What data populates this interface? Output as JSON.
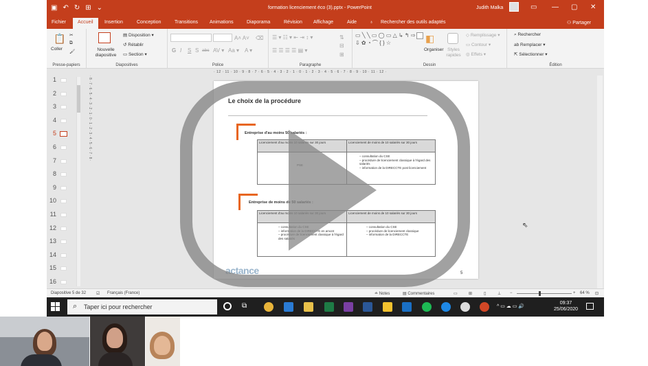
{
  "window": {
    "title": "formation licenciement éco (3).pptx - PowerPoint",
    "user": "Judith Malka",
    "min_icon": "minimize-icon",
    "max_icon": "restore-icon",
    "close_icon": "close-icon"
  },
  "tabs": [
    "Fichier",
    "Accueil",
    "Insertion",
    "Conception",
    "Transitions",
    "Animations",
    "Diaporama",
    "Révision",
    "Affichage",
    "Aide"
  ],
  "tell_me": "Rechercher des outils adaptés",
  "share": "Partager",
  "ribbon": {
    "clipboard": {
      "paste": "Coller",
      "label": "Presse-papiers"
    },
    "slides": {
      "new_slide": "Nouvelle diapositive",
      "layout": "Disposition",
      "reset": "Rétablir",
      "section": "Section",
      "label": "Diapositives"
    },
    "font": {
      "bold": "G",
      "italic": "I",
      "underline": "S",
      "shadow": "S",
      "strike": "abc",
      "label": "Police"
    },
    "paragraph": {
      "label": "Paragraphe"
    },
    "drawing": {
      "arrange": "Organiser",
      "quick_styles": "Styles rapides",
      "fill": "Remplissage",
      "outline": "Contour",
      "effects": "Effets",
      "label": "Dessin"
    },
    "editing": {
      "find": "Rechercher",
      "replace": "Remplacer",
      "select": "Sélectionner",
      "label": "Édition"
    }
  },
  "ruler": "· 12 · 11 · 10 · 9 · 8 · 7 · 6 · 5 · 4 · 3 · 2 · 1 · 0 · 1 · 2 · 3 · 4 · 5 · 6 · 7 · 8 · 9 · 10 · 11 · 12 ·",
  "thumbnails": [
    "1",
    "2",
    "3",
    "4",
    "5",
    "6",
    "7",
    "8",
    "9",
    "10",
    "11",
    "12",
    "13",
    "14",
    "15",
    "16"
  ],
  "selected_slide": "5",
  "slide": {
    "title": "Le choix de la procédure",
    "section1": "Entreprise d'au moins 50 salariés :",
    "section2": "Entreprise de moins de 50 salariés :",
    "table1": {
      "col1": "Licenciement d'au moins 10 salariés sur 30 jours",
      "col2": "Licenciement de moins de 10 salariés sur 30 jours",
      "cell1": "PSE",
      "cell2": [
        "consultation du CSE",
        "procédure de licenciement classique à l'égard des salariés",
        "information de la DIRECCTE post licenciement"
      ]
    },
    "table2": {
      "col1": "Licenciement d'au moins 10 salariés sur 30 jours",
      "col2": "Licenciement de moins de 10 salariés sur 30 jours",
      "cell1": [
        "consultation du CSE",
        "information de la DIRECCTE en amont",
        "procédure de licenciement classique à l'égard des salariés"
      ],
      "cell2": [
        "consultation du CSE",
        "procédure de licenciement classique",
        "information de la DIRECCTE"
      ]
    },
    "logo": "actance",
    "page": "5"
  },
  "status": {
    "slide_count": "Diapositive 5 de 32",
    "language": "Français (France)",
    "notes": "Notes",
    "comments": "Commentaires",
    "zoom": "64 %"
  },
  "taskbar": {
    "search_placeholder": "Taper ici pour rechercher",
    "time": "09:37",
    "date": "25/06/2020",
    "apps": [
      "cortana-icon",
      "task-view-icon",
      "chrome-icon",
      "mail-icon",
      "file-explorer-icon",
      "excel-icon",
      "onenote-icon",
      "word-icon",
      "sticky-notes-icon",
      "outlook-icon",
      "spotify-icon",
      "edge-icon",
      "paint-icon",
      "powerpoint-icon"
    ]
  },
  "overlay": {
    "play_icon": "play-icon"
  },
  "colors": {
    "accent": "#c43e1c",
    "slide_orange": "#e8651c",
    "taskbar": "#1f1f1f"
  }
}
